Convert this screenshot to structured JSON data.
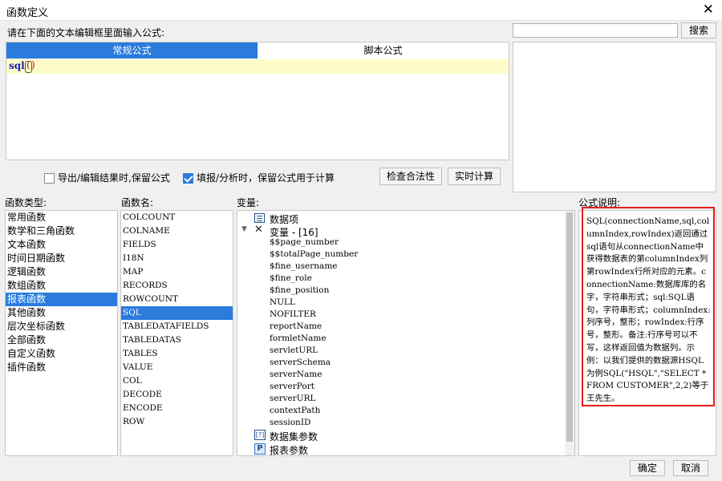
{
  "window": {
    "title": "函数定义",
    "close": "✕"
  },
  "editor": {
    "prompt": "请在下面的文本编辑框里面输入公式:",
    "tabs": [
      {
        "label": "常规公式"
      },
      {
        "label": "脚本公式"
      }
    ],
    "formula_name": "sql",
    "formula_paren_open": "(",
    "formula_paren_close": ")"
  },
  "search": {
    "placeholder": "",
    "value": "",
    "button": "搜索"
  },
  "options": {
    "export_keep": {
      "label": "导出/编辑结果时,保留公式",
      "checked": false
    },
    "fill_keep": {
      "label": "填报/分析时，保留公式用于计算",
      "checked": true
    },
    "check_btn": "检查合法性",
    "realtime_btn": "实时计算"
  },
  "labels": {
    "func_type": "函数类型:",
    "func_name": "函数名:",
    "variables": "变量:",
    "description": "公式说明:"
  },
  "func_types": [
    "常用函数",
    "数学和三角函数",
    "文本函数",
    "时间日期函数",
    "逻辑函数",
    "数组函数",
    "报表函数",
    "其他函数",
    "层次坐标函数",
    "全部函数",
    "自定义函数",
    "插件函数"
  ],
  "func_types_selected": 6,
  "func_names": [
    "COLCOUNT",
    "COLNAME",
    "FIELDS",
    "I18N",
    "MAP",
    "RECORDS",
    "ROWCOUNT",
    "SQL",
    "TABLEDATAFIELDS",
    "TABLEDATAS",
    "TABLES",
    "VALUE",
    "COL",
    "DECODE",
    "ENCODE",
    "ROW"
  ],
  "func_names_selected": 7,
  "vars": {
    "data_item": "数据项",
    "variable_group": "变量 - [16]",
    "variables": [
      "$$page_number",
      "$$totalPage_number",
      "$fine_username",
      "$fine_role",
      "$fine_position",
      "NULL",
      "NOFILTER",
      "reportName",
      "formletName",
      "servletURL",
      "serverSchema",
      "serverName",
      "serverPort",
      "serverURL",
      "contextPath",
      "sessionID"
    ],
    "dataset_params": "数据集参数",
    "report_params": "报表参数"
  },
  "description": {
    "text": "SQL(connectionName,sql,columnIndex,rowIndex)返回通过sql语句从connectionName中获得数据表的第columnIndex列第rowIndex行所对应的元素。connectionName:数据库库的名字，字符串形式；sql:SQL语句，字符串形式；columnIndex:列序号，整形；rowIndex:行序号，整形。备注:行序号可以不写，这样返回值为数据列。示例：以我们提供的数据源HSQL为例SQL(\"HSQL\",\"SELECT * FROM CUSTOMER\",2,2)等于王先生。",
    "highlight_color": "#e02020"
  },
  "footer": {
    "ok": "确定",
    "cancel": "取消"
  },
  "icons": {
    "data_item": "list-icon",
    "variables": "variable-icon",
    "dataset": "dataset-param-icon",
    "report": "report-param-icon"
  },
  "colors": {
    "tab_active": "#2a7bdc",
    "editor_bg": "#fdfcc8",
    "selection": "#2a7bdc"
  }
}
